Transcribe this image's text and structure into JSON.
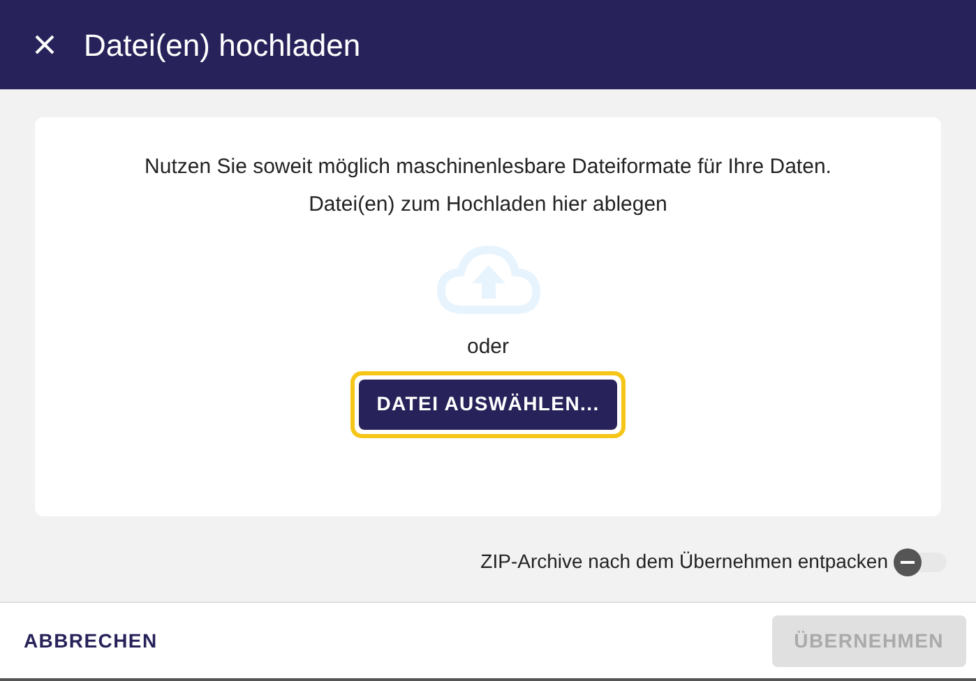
{
  "dialog": {
    "title": "Datei(en) hochladen"
  },
  "dropzone": {
    "hint": "Nutzen Sie soweit möglich maschinenlesbare Dateiformate für Ihre Daten.",
    "prompt": "Datei(en) zum Hochladen hier ablegen",
    "separator": "oder",
    "button": {
      "label": "DATEI AUSWÄHLEN...",
      "focused": true
    }
  },
  "option": {
    "label": "ZIP-Archive nach dem Übernehmen entpacken",
    "on": false
  },
  "footer": {
    "buttons": [
      {
        "label": "ABBRECHEN",
        "disabled": false
      },
      {
        "label": "ÜBERNEHMEN",
        "disabled": true
      }
    ]
  }
}
